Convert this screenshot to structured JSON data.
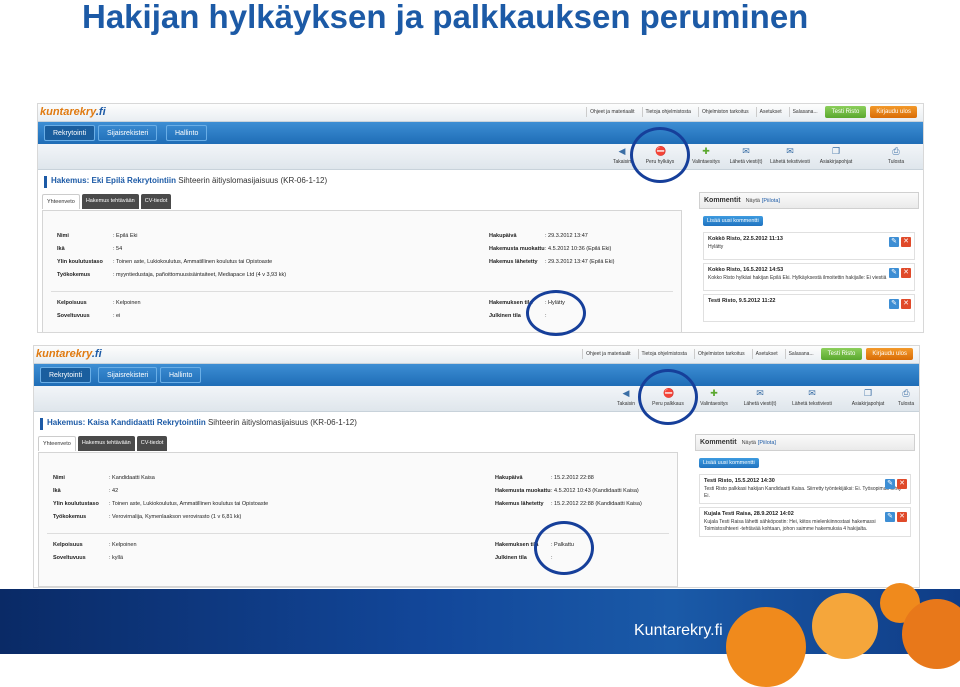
{
  "slide": {
    "title": "Hakijan hylkäyksen ja palkkauksen peruminen"
  },
  "app": {
    "logo_a": "kuntarekry",
    "logo_b": ".fi",
    "top_links": [
      "Ohjeet ja materiaalit",
      "Tietoja ohjelmistosta",
      "Ohjelmiston tarkoitus",
      "Asetukset",
      "Salasana..."
    ],
    "user_button": "Testi Risto",
    "logout_button": "Kirjaudu ulos",
    "nav_tabs": [
      "Rekrytointi",
      "Sijaisrekisteri",
      "Hallinto"
    ],
    "tabs": [
      "Yhteenveto",
      "Hakemus tehtävään",
      "CV-tiedot"
    ],
    "labels": {
      "nimi": "Nimi",
      "ika": "Ikä",
      "ylin": "Ylin koulutustaso",
      "tyokokemus": "Työkokemus",
      "hakupaiva": "Hakupäivä",
      "muokattu": "Hakemusta muokattu",
      "lahetetty": "Hakemus lähetetty",
      "kelpoisuus": "Kelpoisuus",
      "soveltuvuus": "Soveltuvuus",
      "tila": "Hakemuksen tila",
      "julkinen": "Julkinen tila"
    },
    "comments_title": "Kommentit",
    "comments_show": "Näytä",
    "comments_hide": "[Piilota]",
    "add_comment": "Lisää uusi kommentti"
  },
  "shot1": {
    "toolbar": [
      "Takaisin",
      "Peru hylkäys",
      "Valintaesitys",
      "Lähetä viesti(t)",
      "Lähetä tekstiviesti",
      "Asiakirjapohjat",
      "Tulosta"
    ],
    "hakemus_prefix": "Hakemus:",
    "applicant": "Eki Epilä Rekrytointiin",
    "role": "Sihteerin äitiyslomasijaisuus (KR-06-1-12)",
    "values": {
      "nimi": ": Epilä Eki",
      "ika": ": 54",
      "ylin": ": Toinen aste, Lukiokoulutus, Ammatillinen koulutus tai Opistoaste",
      "tyokokemus": ": myyntiedustaja, pañoittomuusisäintaiteet, Mediapace Ltd (4 v 3,93 kk)",
      "hakupaiva": ": 29.3.2012 13:47",
      "muokattu": ": 4.5.2012 10:36 (Epilä Eki)",
      "lahetetty": ": 29.3.2012 13:47 (Epilä Eki)",
      "kelpoisuus": ": Kelpoinen",
      "soveltuvuus": ": ei",
      "tila": ": Hylätty",
      "julkinen": ":"
    },
    "comments": [
      {
        "head": "Kokkö Risto, 22.5.2012 11:13",
        "text": "Hylätty"
      },
      {
        "head": "Kokko Risto, 16.5.2012 14:53",
        "text": "Kokko Risto hylkäsi hakijan Epilä Eki. Hylkäyksestä ilmoitettin hakijalle: Ei viestiä"
      },
      {
        "head": "Testi Risto, 9.5.2012 11:22",
        "text": ""
      }
    ]
  },
  "shot2": {
    "toolbar": [
      "Takaisin",
      "Peru palkkaus",
      "Valintaesitys",
      "Lähetä viesti(t)",
      "Lähetä tekstiviesti",
      "Asiakirjapohjat",
      "Tulosta"
    ],
    "hakemus_prefix": "Hakemus:",
    "applicant": "Kaisa Kandidaatti Rekrytointiin",
    "role": "Sihteerin äitiyslomasijaisuus (KR-06-1-12)",
    "values": {
      "nimi": ": Kandidaatti Kaisa",
      "ika": ": 42",
      "ylin": ": Toinen aste, Lukiokoulutus, Ammatillinen koulutus tai Opistoaste",
      "tyokokemus": ": Verovirnalija, Kymenlaakson verovirasto (1 v 6,81 kk)",
      "hakupaiva": ": 15.2.2012 22:88",
      "muokattu": ": 4.5.2012 10:43 (Kandidaatti Kaisa)",
      "lahetetty": ": 15.2.2012 22:88 (Kandidaatti Kaisa)",
      "kelpoisuus": ": Kelpoinen",
      "soveltuvuus": ": kyllä",
      "tila": ": Palkattu",
      "julkinen": ":"
    },
    "comments": [
      {
        "head": "Testi Risto, 15.5.2012 14:30",
        "text": "Testi Risto palkkasi hakijan Kandidaatti Kaisa. Siirretty työntekijäksi: Ei. Työsopimus tehty Ei."
      },
      {
        "head": "Kujala Testi Raisa, 28.9.2012 14:02",
        "text": "Kujala Testi Raisa lähetti sähköpostin: Hei, kiitos mielenkiinnostasi hakemassi Toimistosihteeri -tehtävää kohtaan, johon saimme hakemuksia 4 hakijalta."
      }
    ]
  },
  "footer": {
    "logo_text": "Kuntarekry.fi"
  },
  "colors": {
    "title": "#1c5aa6",
    "circle": "#163f9a",
    "accent_orange": "#e07a10"
  }
}
